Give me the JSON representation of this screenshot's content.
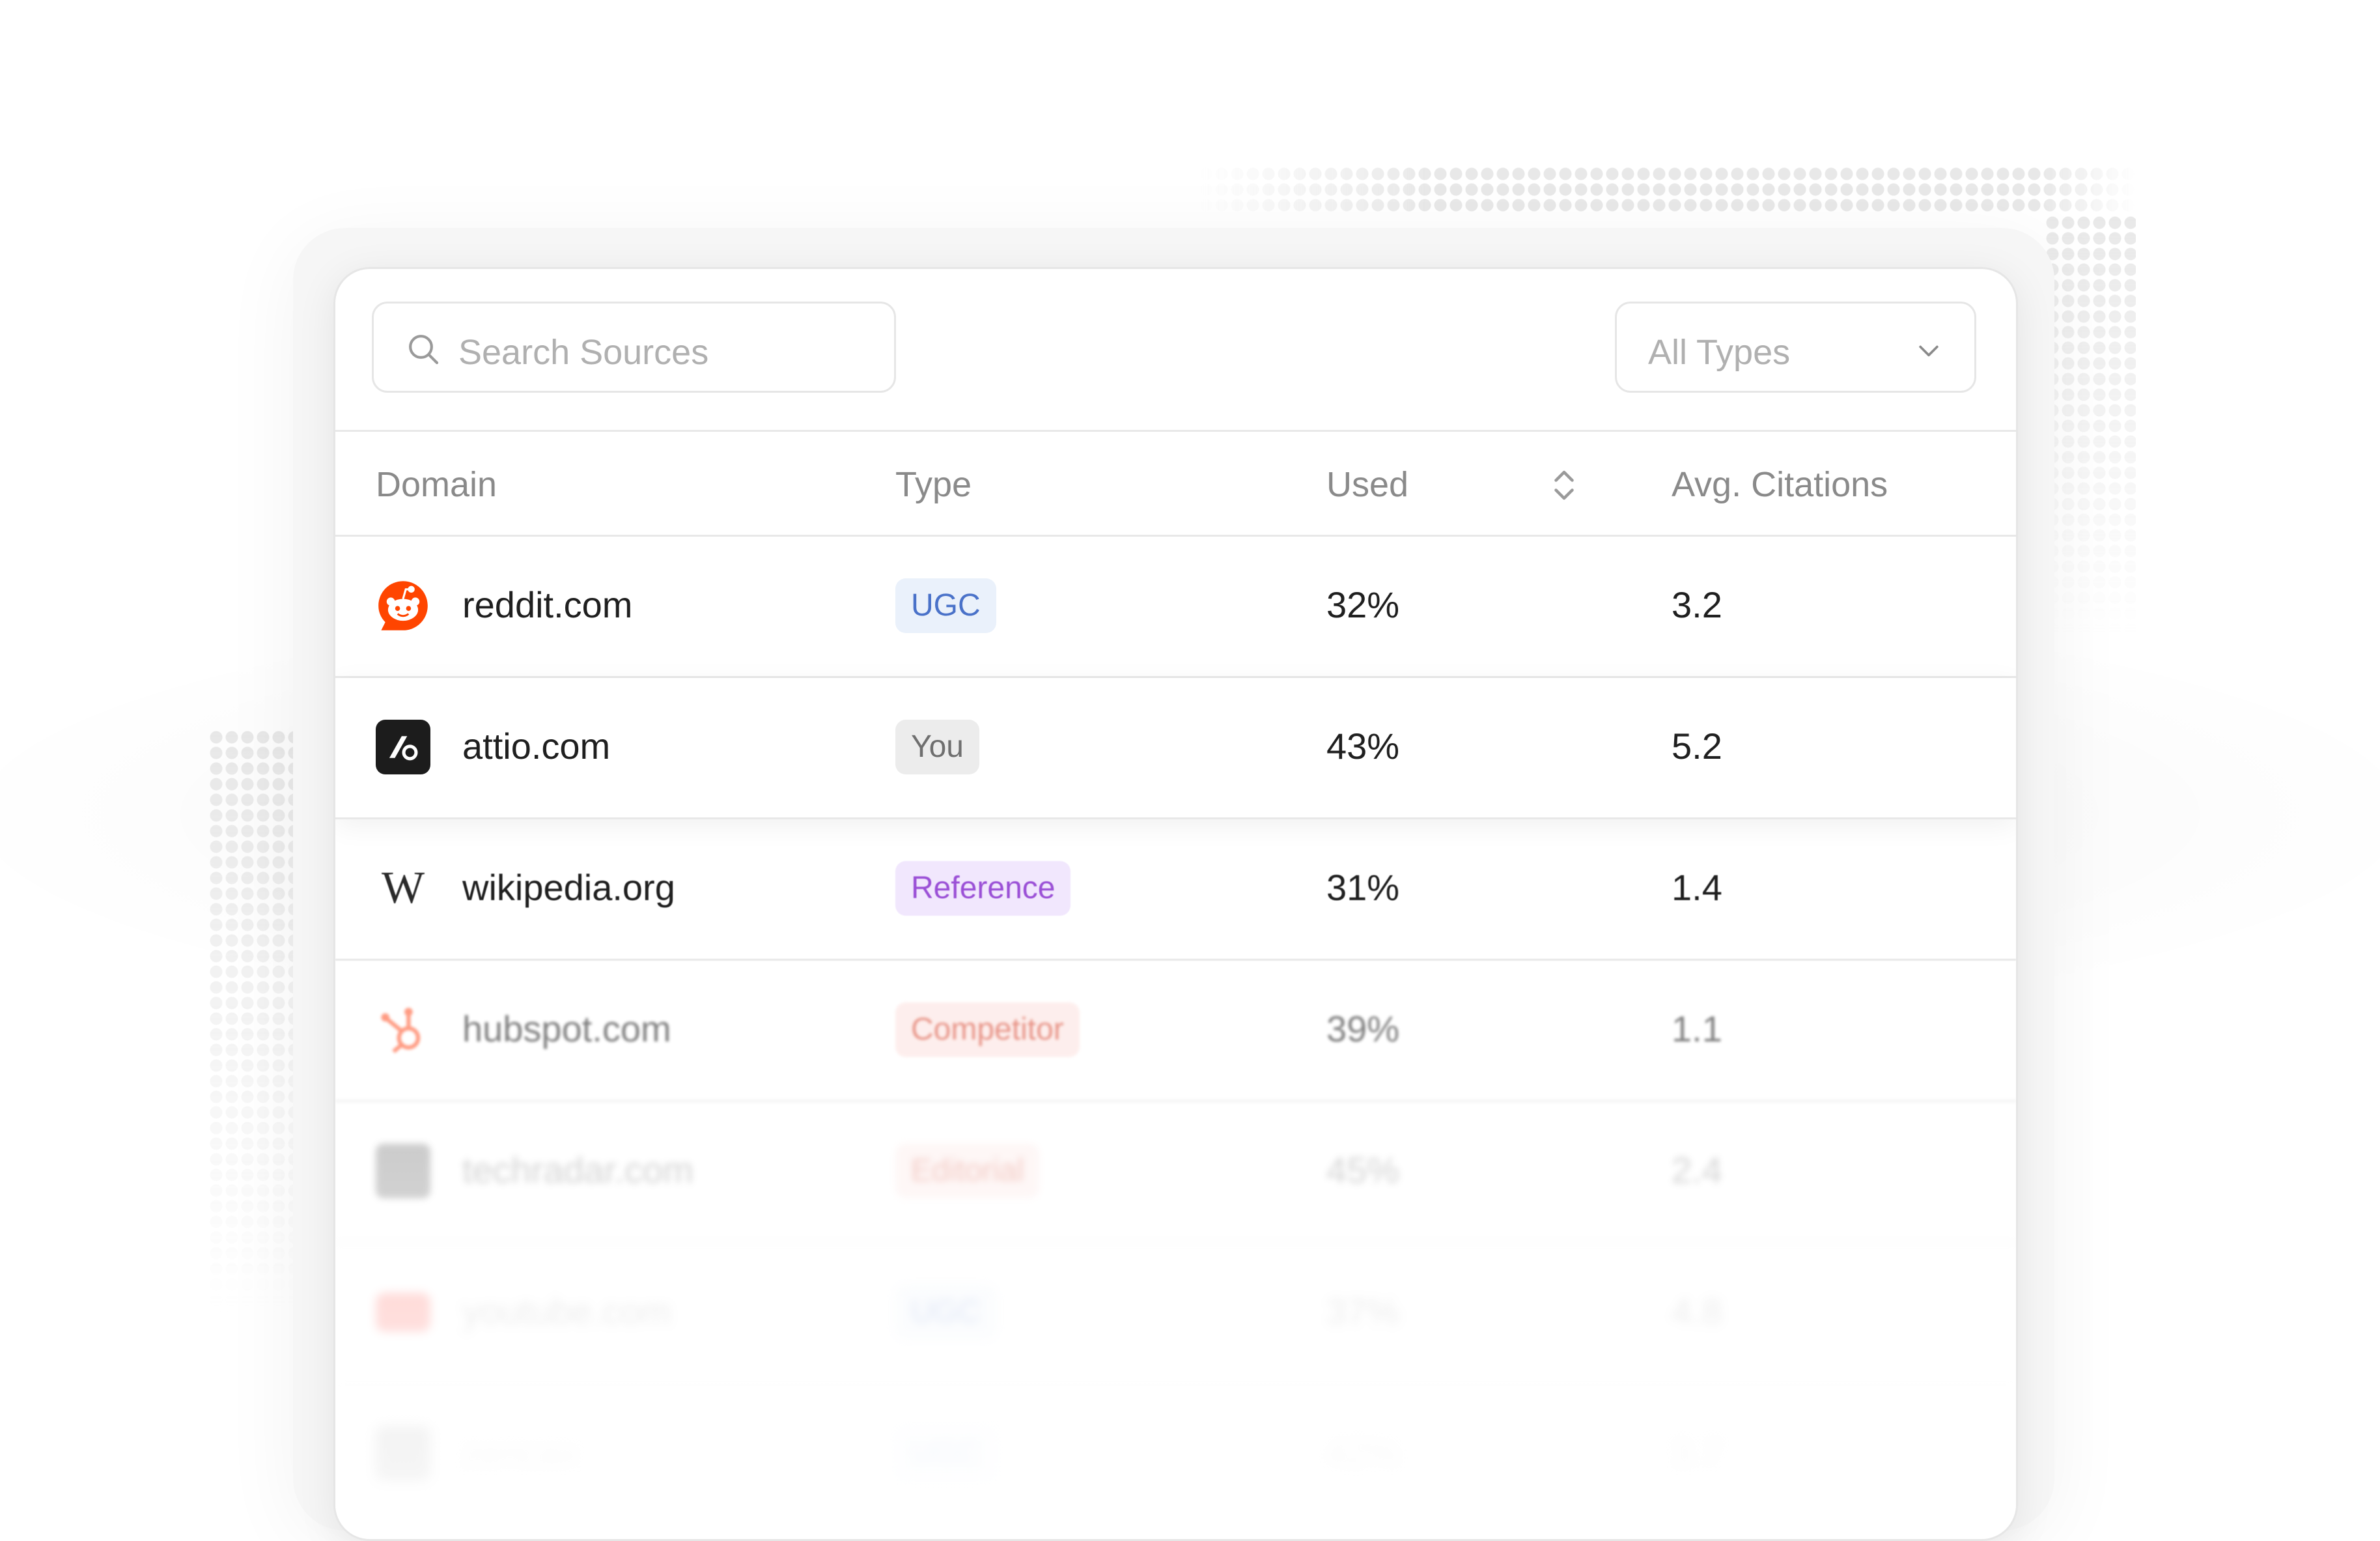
{
  "search": {
    "placeholder": "Search Sources"
  },
  "filter": {
    "selected": "All Types"
  },
  "columns": {
    "domain": "Domain",
    "type": "Type",
    "used": "Used",
    "citations": "Avg. Citations"
  },
  "rows": [
    {
      "domain": "reddit.com",
      "type": "UGC",
      "used": "32%",
      "citations": "3.2",
      "icon": "reddit-icon"
    },
    {
      "domain": "attio.com",
      "type": "You",
      "used": "43%",
      "citations": "5.2",
      "icon": "attio-icon"
    },
    {
      "domain": "wikipedia.org",
      "type": "Reference",
      "used": "31%",
      "citations": "1.4",
      "icon": "wikipedia-icon"
    },
    {
      "domain": "hubspot.com",
      "type": "Competitor",
      "used": "39%",
      "citations": "1.1",
      "icon": "hubspot-icon"
    },
    {
      "domain": "techradar.com",
      "type": "Editorial",
      "used": "45%",
      "citations": "2.4",
      "icon": "techradar-icon"
    },
    {
      "domain": "youtube.com",
      "type": "UGC",
      "used": "37%",
      "citations": "4.8",
      "icon": "youtube-icon"
    },
    {
      "domain": "zencax",
      "type": "UGC",
      "used": "42%",
      "citations": "3.7",
      "icon": "site-icon"
    }
  ],
  "colors": {
    "reddit": "#ff4500",
    "attio": "#1c1c1c",
    "hubspot": "#ff7a59",
    "youtube": "#ff0000"
  }
}
